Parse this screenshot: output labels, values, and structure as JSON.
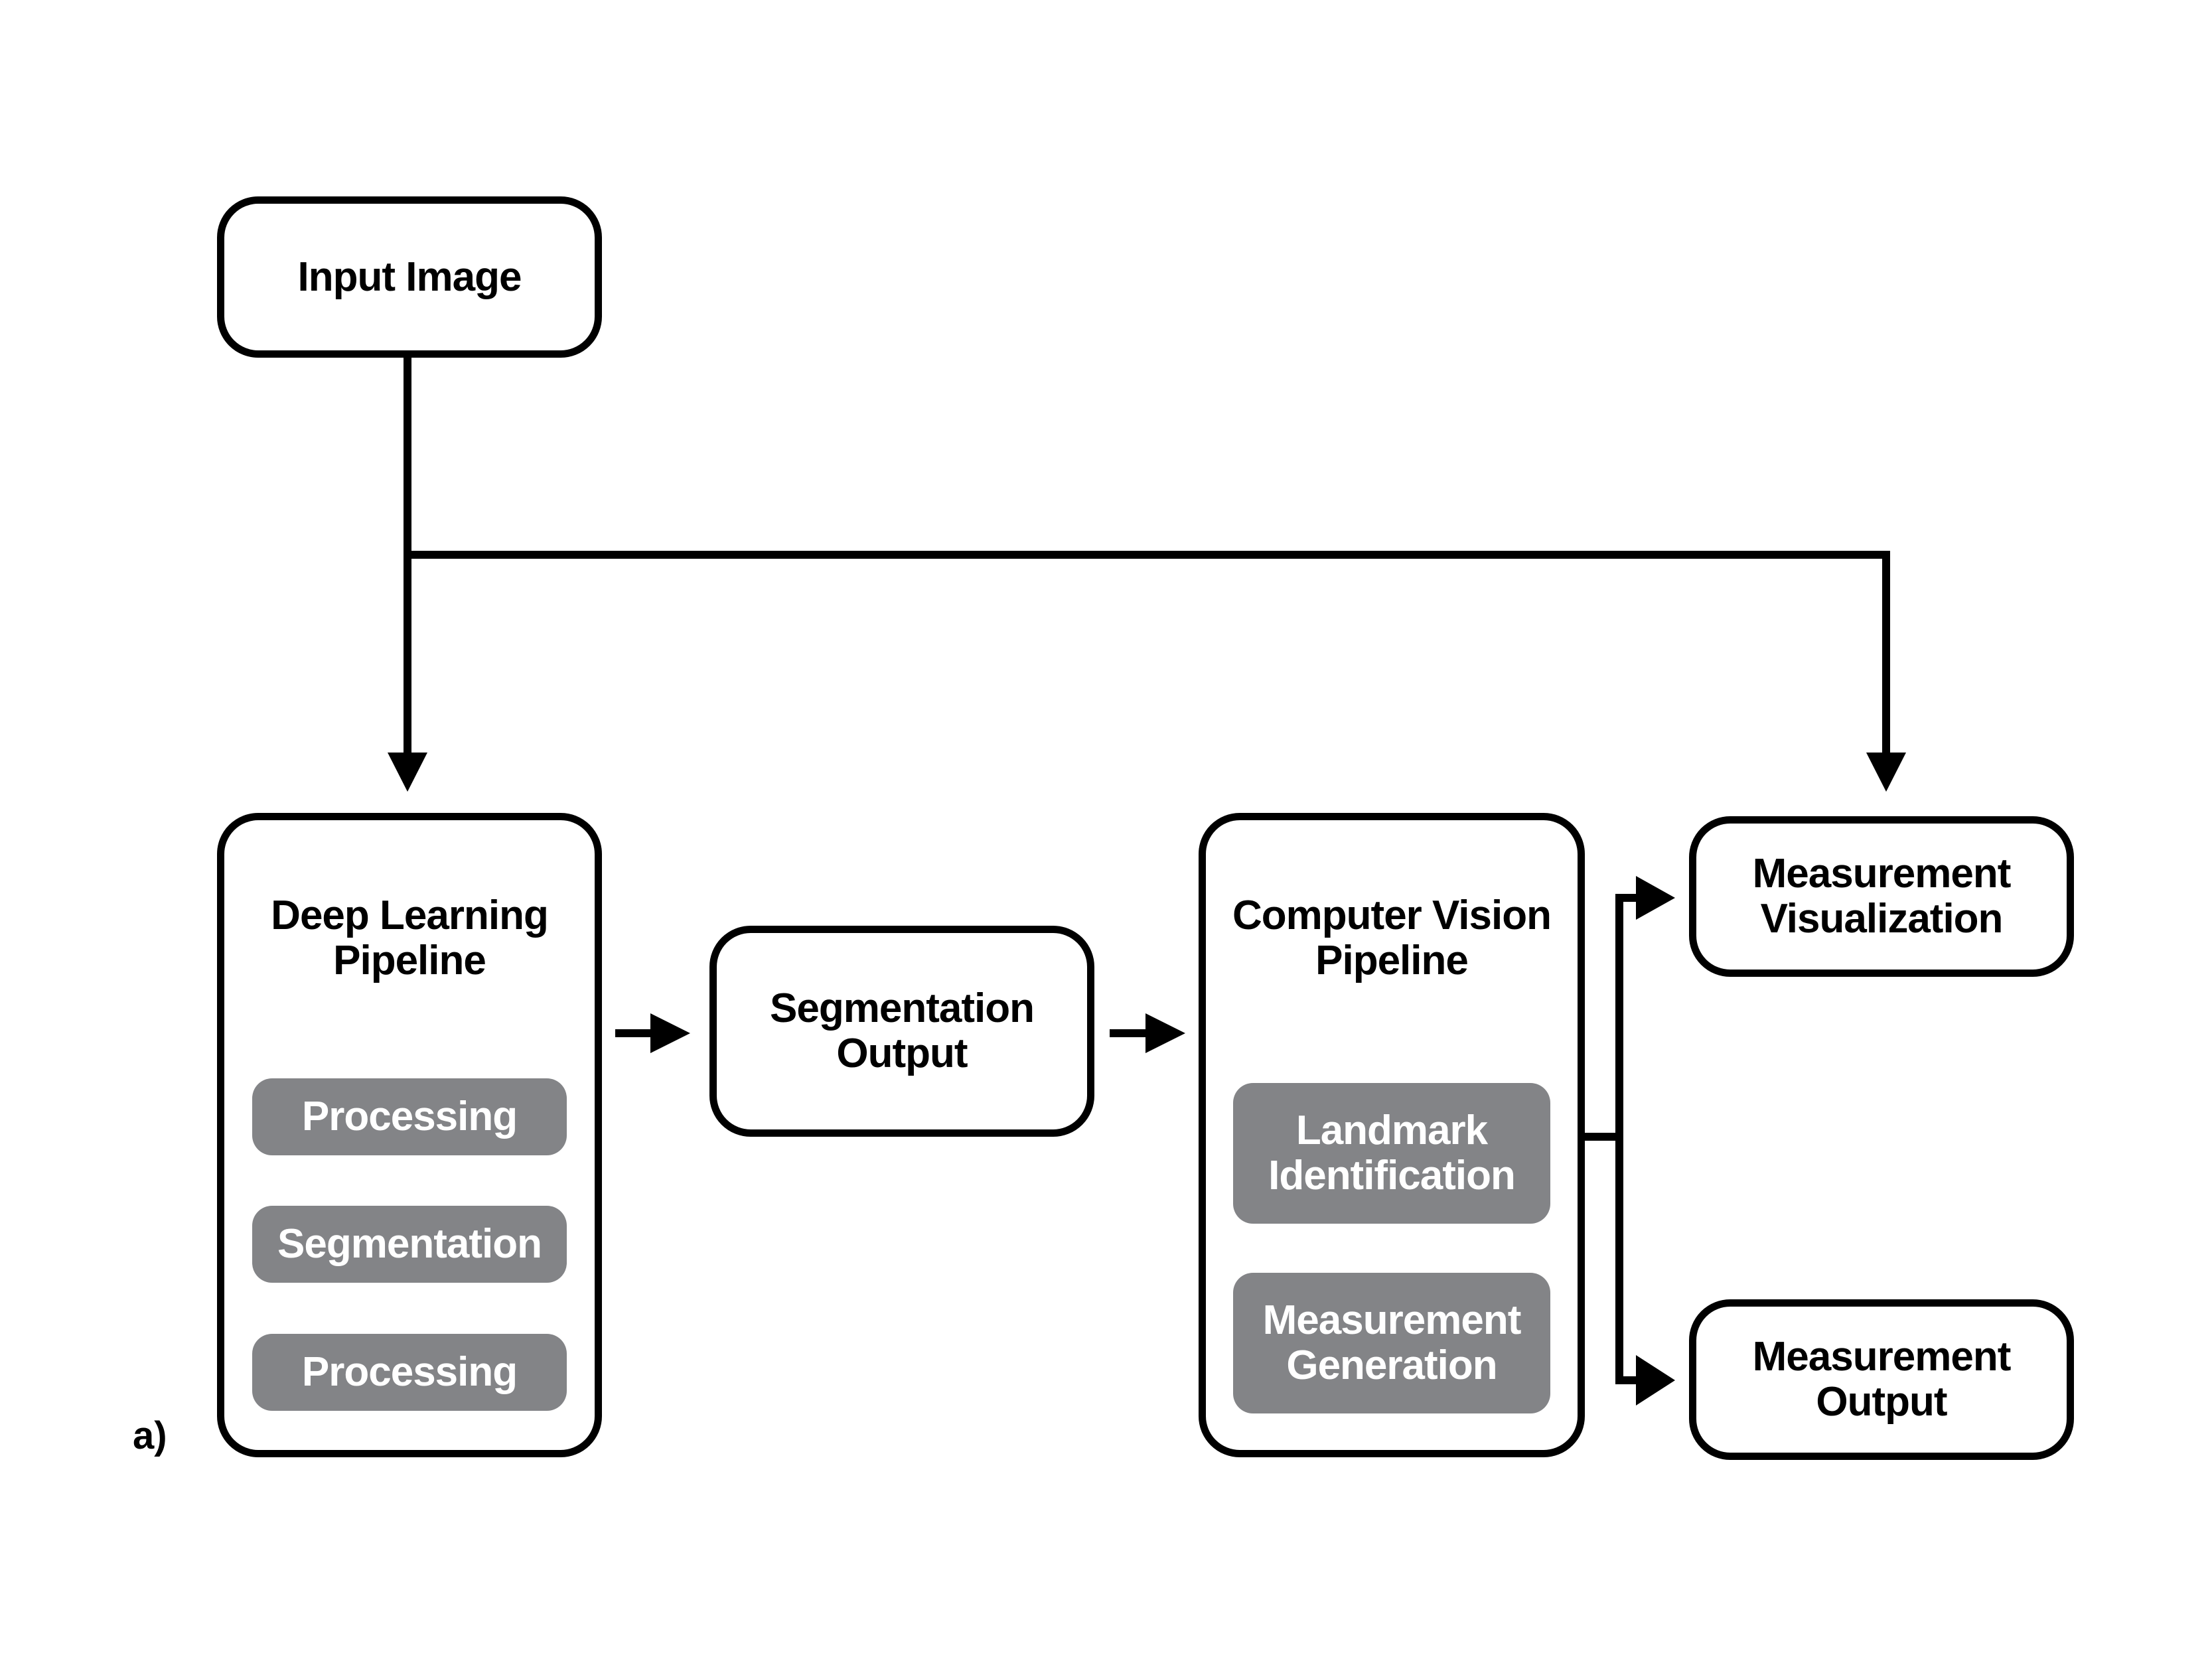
{
  "diagram": {
    "panel_label": "a)",
    "nodes": {
      "input_image": {
        "label": "Input Image"
      },
      "deep_learning_pipeline": {
        "label": "Deep Learning\nPipeline",
        "steps": [
          "Processing",
          "Segmentation",
          "Processing"
        ]
      },
      "segmentation_output": {
        "label": "Segmentation\nOutput"
      },
      "computer_vision_pipeline": {
        "label": "Computer Vision\nPipeline",
        "steps": [
          "Landmark\nIdentification",
          "Measurement\nGeneration"
        ]
      },
      "measurement_visualization": {
        "label": "Measurement\nVisualization"
      },
      "measurement_output": {
        "label": "Measurement\nOutput"
      }
    },
    "edges": [
      {
        "from": "Input Image",
        "to": "Deep Learning Pipeline"
      },
      {
        "from": "Input Image",
        "to": "Measurement Visualization"
      },
      {
        "from": "Deep Learning Pipeline",
        "to": "Segmentation Output"
      },
      {
        "from": "Segmentation Output",
        "to": "Computer Vision Pipeline"
      },
      {
        "from": "Computer Vision Pipeline",
        "to": "Measurement Visualization"
      },
      {
        "from": "Computer Vision Pipeline",
        "to": "Measurement Output"
      }
    ],
    "colors": {
      "stroke": "#000000",
      "step_fill": "#838487",
      "step_text": "#ffffff",
      "background": "#ffffff"
    }
  }
}
